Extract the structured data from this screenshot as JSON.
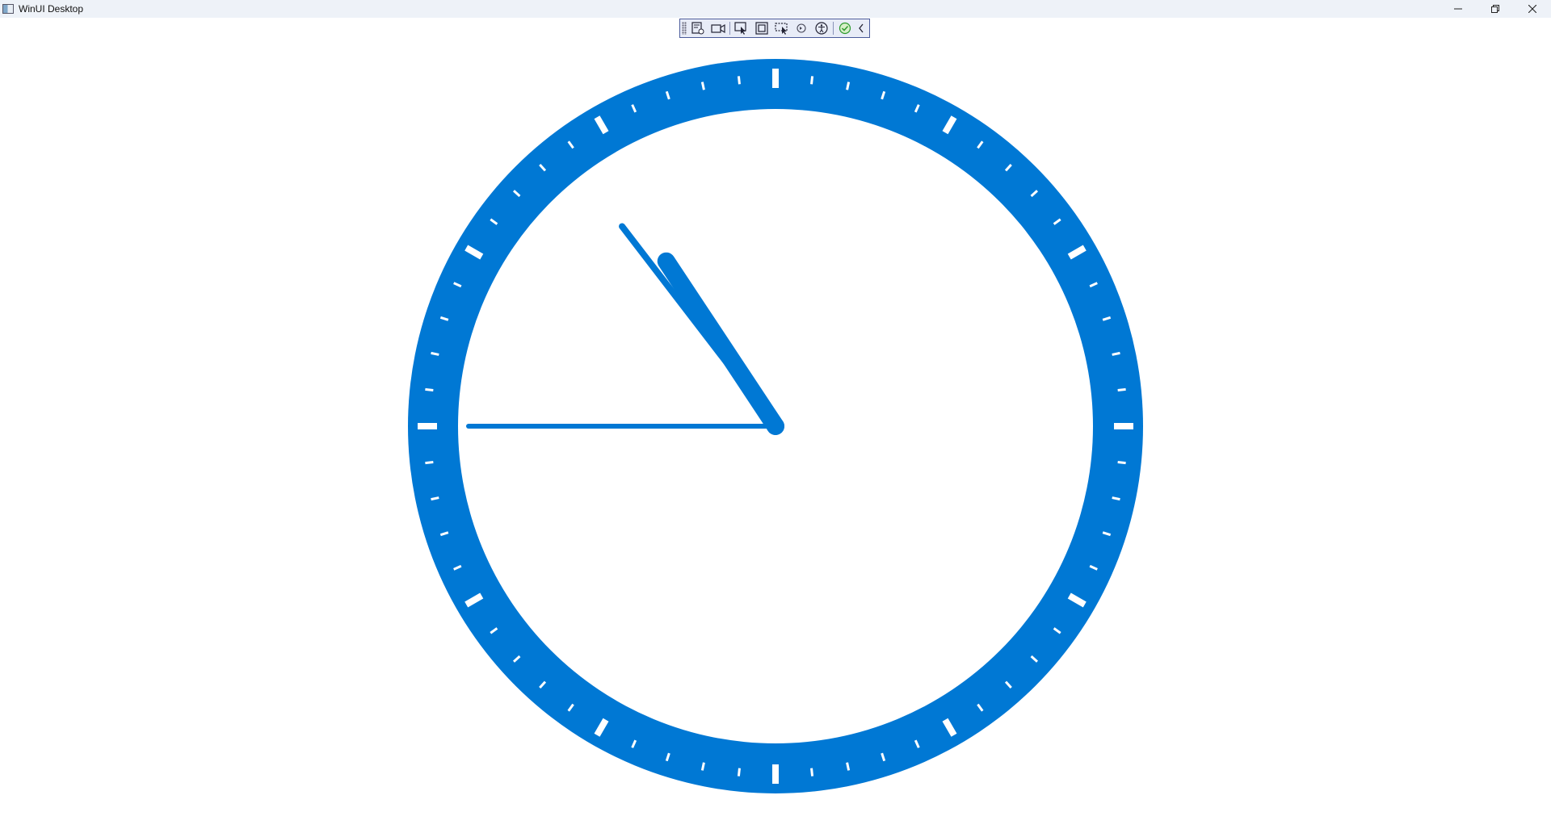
{
  "window": {
    "title": "WinUI Desktop"
  },
  "caption": {
    "minimize_icon": "minimize-icon",
    "restore_icon": "restore-icon",
    "close_icon": "close-icon"
  },
  "debug_toolbar": {
    "tools": [
      {
        "name": "live-visual-tree-icon"
      },
      {
        "name": "video-icon"
      },
      {
        "name": "select-element-icon"
      },
      {
        "name": "display-layout-adorners-icon"
      },
      {
        "name": "track-focus-icon"
      },
      {
        "name": "hot-reload-icon"
      },
      {
        "name": "accessibility-icon"
      },
      {
        "name": "check-icon"
      },
      {
        "name": "collapse-chevron-icon"
      }
    ]
  },
  "clock": {
    "time": {
      "hour": 10,
      "minute": 53,
      "second": 45
    },
    "colors": {
      "accent": "#0078d4",
      "tick": "#ffffff",
      "background": "#ffffff"
    }
  }
}
